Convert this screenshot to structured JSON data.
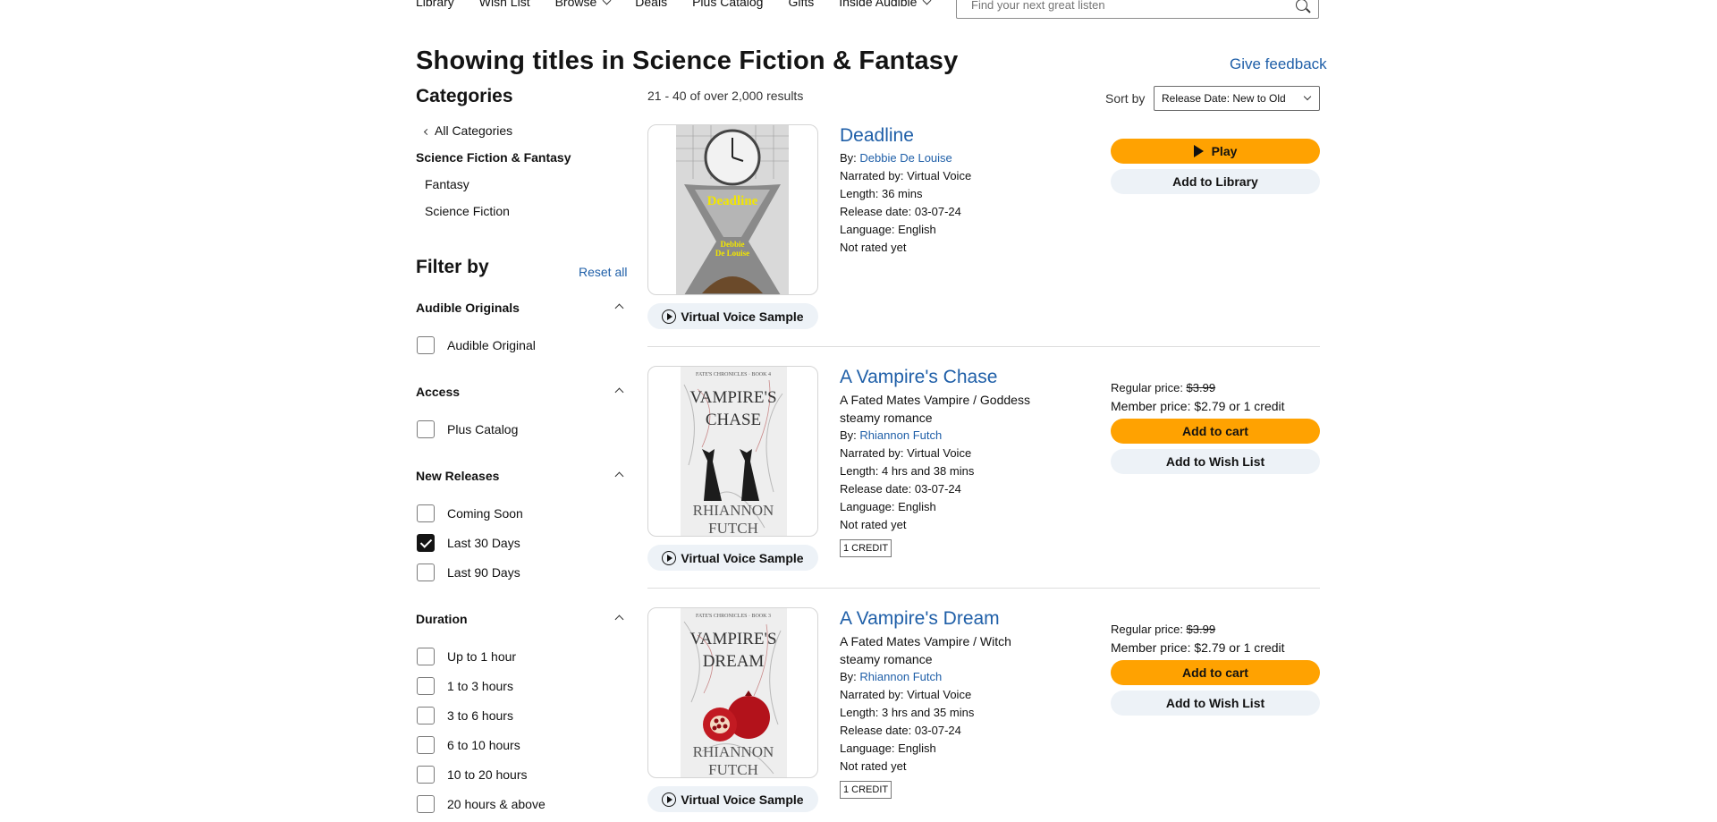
{
  "nav": {
    "items": [
      "Library",
      "Wish List",
      "Browse",
      "Deals",
      "Plus Catalog",
      "Gifts",
      "Inside Audible"
    ],
    "search_placeholder": "Find your next great listen"
  },
  "header": {
    "title": "Showing titles in Science Fiction & Fantasy",
    "feedback": "Give feedback"
  },
  "sidebar": {
    "categories_heading": "Categories",
    "all_categories": "All Categories",
    "current": "Science Fiction & Fantasy",
    "subcategories": [
      "Fantasy",
      "Science Fiction"
    ],
    "filter_heading": "Filter by",
    "reset": "Reset all",
    "groups": [
      {
        "heading": "Audible Originals",
        "options": [
          {
            "label": "Audible Original",
            "checked": false
          }
        ]
      },
      {
        "heading": "Access",
        "options": [
          {
            "label": "Plus Catalog",
            "checked": false
          }
        ]
      },
      {
        "heading": "New Releases",
        "options": [
          {
            "label": "Coming Soon",
            "checked": false
          },
          {
            "label": "Last 30 Days",
            "checked": true
          },
          {
            "label": "Last 90 Days",
            "checked": false
          }
        ]
      },
      {
        "heading": "Duration",
        "options": [
          {
            "label": "Up to 1 hour",
            "checked": false
          },
          {
            "label": "1 to 3 hours",
            "checked": false
          },
          {
            "label": "3 to 6 hours",
            "checked": false
          },
          {
            "label": "6 to 10 hours",
            "checked": false
          },
          {
            "label": "10 to 20 hours",
            "checked": false
          },
          {
            "label": "20 hours & above",
            "checked": false
          }
        ]
      }
    ]
  },
  "results": {
    "count": "21 - 40 of over 2,000 results",
    "sort_label": "Sort by",
    "sort_value": "Release Date: New to Old",
    "sample_label": "Virtual Voice Sample",
    "items": [
      {
        "title": "Deadline",
        "subtitle": "",
        "by_label": "By:",
        "author": "Debbie De Louise",
        "narrated": "Narrated by: Virtual Voice",
        "length": "Length: 36 mins",
        "release": "Release date: 03-07-24",
        "language": "Language: English",
        "rating": "Not rated yet",
        "credit_badge": "",
        "regular_price_label": "",
        "regular_price": "",
        "member_price": "",
        "primary_button": "Play",
        "secondary_button": "Add to Library",
        "cover_title": "Deadline",
        "cover_author_line1": "Debbie",
        "cover_author_line2": "De Louise"
      },
      {
        "title": "A Vampire's Chase",
        "subtitle": "A Fated Mates Vampire / Goddess steamy romance",
        "by_label": "By:",
        "author": "Rhiannon Futch",
        "narrated": "Narrated by: Virtual Voice",
        "length": "Length: 4 hrs and 38 mins",
        "release": "Release date: 03-07-24",
        "language": "Language: English",
        "rating": "Not rated yet",
        "credit_badge": "1 CREDIT",
        "regular_price_label": "Regular price: ",
        "regular_price": "$3.99",
        "member_price": "Member price: $2.79 or 1 credit",
        "primary_button": "Add to cart",
        "secondary_button": "Add to Wish List",
        "cover_series": "FATE'S CHRONICLES · BOOK 4",
        "cover_title_line1": "VAMPIRE'S",
        "cover_title_line2": "CHASE",
        "cover_author_line1": "RHIANNON",
        "cover_author_line2": "FUTCH"
      },
      {
        "title": "A Vampire's Dream",
        "subtitle": "A Fated Mates Vampire / Witch steamy romance",
        "by_label": "By:",
        "author": "Rhiannon Futch",
        "narrated": "Narrated by: Virtual Voice",
        "length": "Length: 3 hrs and 35 mins",
        "release": "Release date: 03-07-24",
        "language": "Language: English",
        "rating": "Not rated yet",
        "credit_badge": "1 CREDIT",
        "regular_price_label": "Regular price: ",
        "regular_price": "$3.99",
        "member_price": "Member price: $2.79 or 1 credit",
        "primary_button": "Add to cart",
        "secondary_button": "Add to Wish List",
        "cover_series": "FATE'S CHRONICLES · BOOK 3",
        "cover_title_line1": "VAMPIRE'S",
        "cover_title_line2": "DREAM",
        "cover_author_line1": "RHIANNON",
        "cover_author_line2": "FUTCH"
      }
    ]
  },
  "colors": {
    "link": "#1f5fa8",
    "button_orange": "#ffa201",
    "button_grey": "#edf2f7"
  }
}
